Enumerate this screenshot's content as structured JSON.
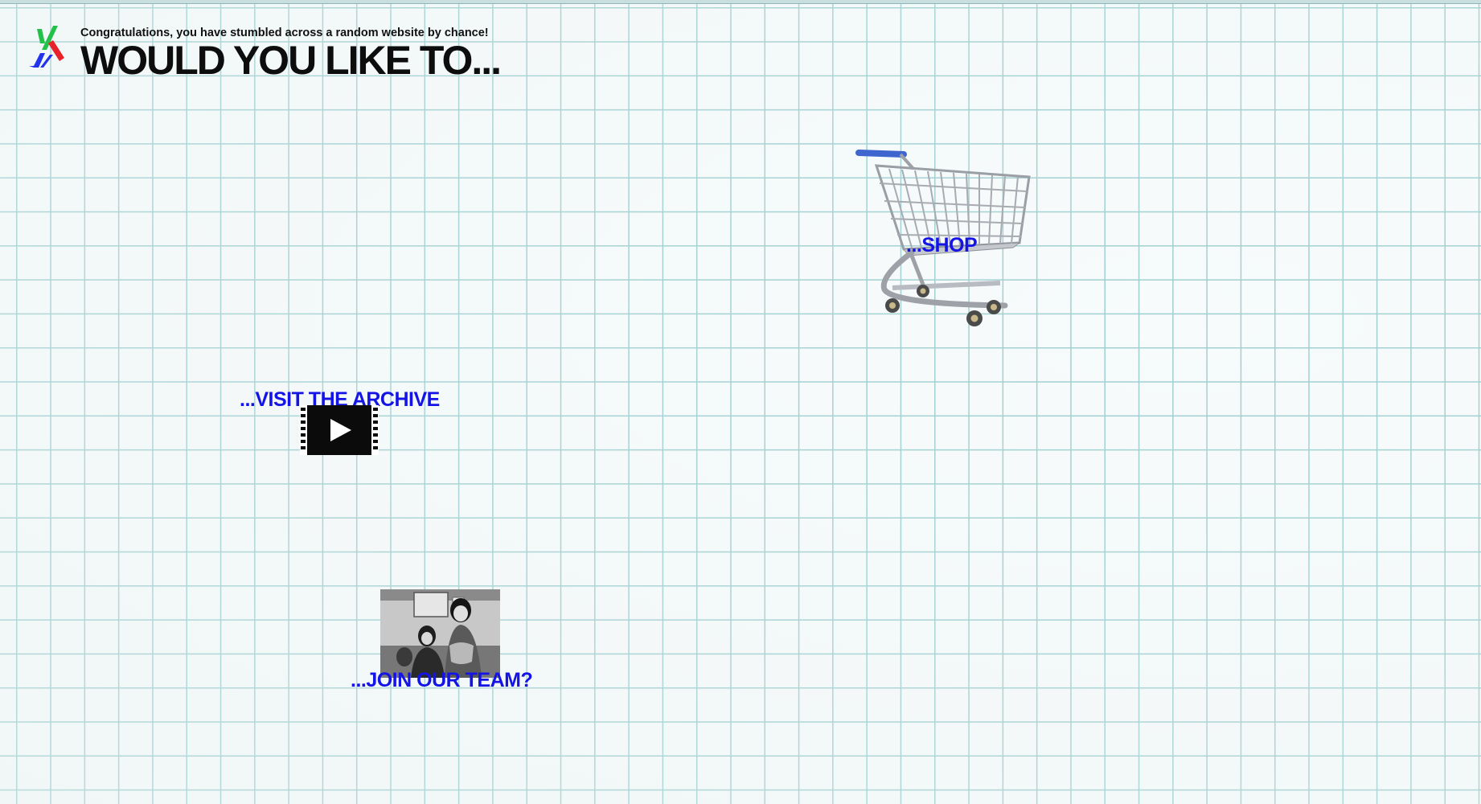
{
  "header": {
    "tagline": "Congratulations, you have stumbled across a random website by chance!",
    "headline": "WOULD YOU LIKE TO...",
    "logo_icon": "vn-logo-icon"
  },
  "links": {
    "shop": "...SHOP",
    "archive": "...VISIT THE ARCHIVE",
    "team": "...JOIN OUR TEAM?"
  },
  "images": {
    "cart": "shopping-cart-icon",
    "film": "film-play-icon",
    "team_photo": "team-photo"
  },
  "colors": {
    "link": "#1414e6",
    "grid": "#9fcfd0",
    "background": "#f7fbfb",
    "headline": "#0d0d0d",
    "logo_green": "#22c24a",
    "logo_red": "#e8222a",
    "logo_blue": "#2233ee"
  }
}
